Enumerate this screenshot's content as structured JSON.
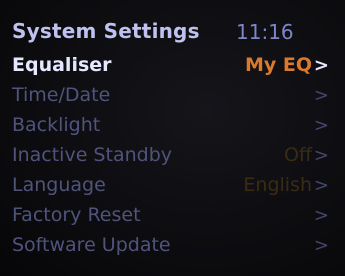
{
  "header": {
    "title": "System Settings",
    "time": "11:16"
  },
  "menu": {
    "items": [
      {
        "label": "Equaliser",
        "value": "My EQ",
        "arrow": ">",
        "selected": true
      },
      {
        "label": "Time/Date",
        "value": "",
        "arrow": ">"
      },
      {
        "label": "Backlight",
        "value": "",
        "arrow": ">"
      },
      {
        "label": "Inactive Standby",
        "value": "Off",
        "arrow": ">"
      },
      {
        "label": "Language",
        "value": "English",
        "arrow": ">"
      },
      {
        "label": "Factory Reset",
        "value": "",
        "arrow": ">"
      },
      {
        "label": "Software Update",
        "value": "",
        "arrow": ">"
      }
    ]
  },
  "colors": {
    "title": "#bfc2f0",
    "clock": "#7f85c9",
    "selected_label": "#e6e8ff",
    "selected_value": "#d97a2e",
    "dim_label": "#50537c",
    "dim_value": "#3a2c12"
  }
}
